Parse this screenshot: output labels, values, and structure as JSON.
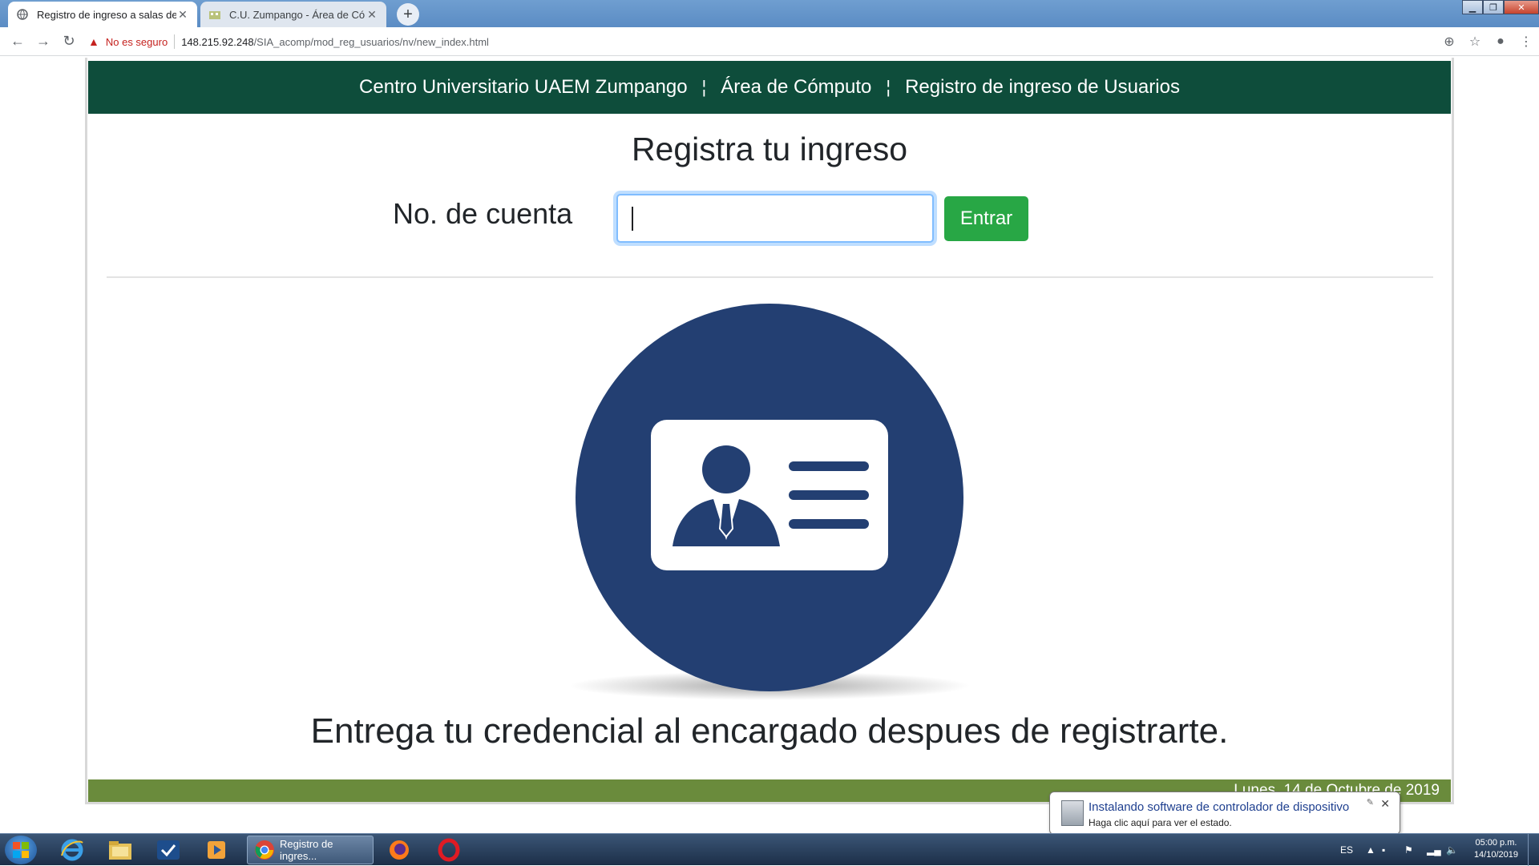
{
  "browser": {
    "tabs": [
      {
        "title": "Registro de ingreso a salas de có",
        "active": true
      },
      {
        "title": "C.U. Zumpango - Área de Cómpu",
        "active": false
      }
    ],
    "security_label": "No es seguro",
    "url_host": "148.215.92.248",
    "url_path": "/SIA_acomp/mod_reg_usuarios/nv/new_index.html"
  },
  "header": {
    "items": [
      "Centro Universitario UAEM Zumpango",
      "Área de Cómputo",
      "Registro de ingreso de Usuarios"
    ],
    "divider": "¦"
  },
  "form": {
    "heading": "Registra tu ingreso",
    "account_label": "No. de cuenta",
    "account_value": "",
    "submit_label": "Entrar"
  },
  "instruction": "Entrega tu credencial al encargado despues de registrarte.",
  "footer": {
    "date": "Lunes, 14 de Octubre de 2019"
  },
  "notification": {
    "title": "Instalando software de controlador de dispositivo",
    "subtitle": "Haga clic aquí para ver el estado."
  },
  "taskbar": {
    "chrome_task_label": "Registro de ingres...",
    "language": "ES",
    "time": "05:00 p.m.",
    "date": "14/10/2019"
  },
  "colors": {
    "header_bg": "#0e4d3b",
    "footer_bg": "#6a8b3c",
    "button_bg": "#28a745",
    "badge_circle": "#233f72"
  }
}
